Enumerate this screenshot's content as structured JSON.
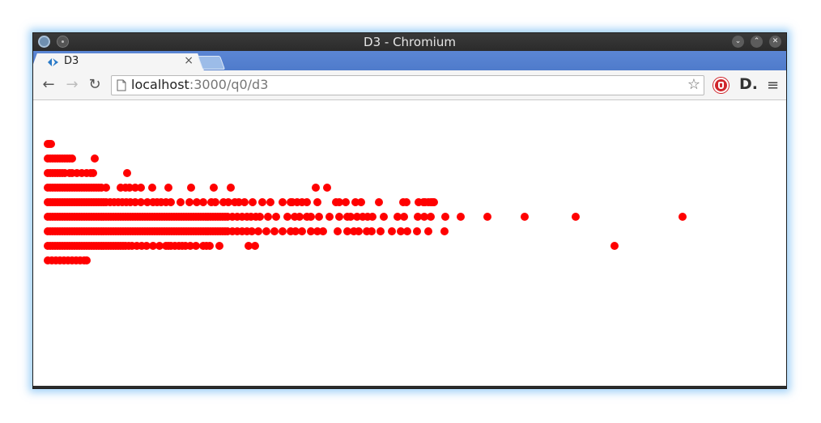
{
  "window": {
    "title": "D3 - Chromium"
  },
  "tab": {
    "title": "D3",
    "close_label": "×"
  },
  "toolbar": {
    "back_label": "←",
    "forward_label": "→",
    "reload_label": "↻",
    "url_host": "localhost",
    "url_path": ":3000/q0/d3",
    "star_label": "☆",
    "ext_d_label": "D.",
    "menu_label": "≡"
  },
  "colors": {
    "dot": "#ff0000",
    "tabstrip": "#5b86d4"
  },
  "chart_data": {
    "type": "scatter",
    "title": "",
    "xlabel": "",
    "ylabel": "",
    "grid": false,
    "legend": "none",
    "series": [
      {
        "row": 0,
        "x": [
          0,
          2,
          4
        ]
      },
      {
        "row": 1,
        "x": [
          0,
          3,
          6,
          9,
          12,
          15,
          18,
          21,
          24,
          27,
          30,
          58
        ]
      },
      {
        "row": 2,
        "x": [
          0,
          3,
          6,
          9,
          12,
          15,
          18,
          21,
          27,
          30,
          36,
          42,
          48,
          53,
          56,
          98
        ]
      },
      {
        "row": 3,
        "x": [
          0,
          3,
          6,
          9,
          12,
          15,
          18,
          21,
          24,
          27,
          30,
          33,
          36,
          39,
          42,
          45,
          48,
          51,
          54,
          57,
          60,
          63,
          66,
          72,
          90,
          96,
          101,
          108,
          115,
          129,
          149,
          177,
          205,
          226,
          331,
          345
        ]
      },
      {
        "row": 4,
        "x": [
          0,
          3,
          6,
          9,
          12,
          15,
          18,
          21,
          24,
          27,
          30,
          33,
          36,
          39,
          42,
          45,
          48,
          51,
          54,
          57,
          60,
          63,
          66,
          69,
          72,
          77,
          82,
          87,
          92,
          97,
          102,
          108,
          115,
          123,
          130,
          135,
          140,
          146,
          152,
          164,
          175,
          184,
          192,
          202,
          207,
          217,
          223,
          231,
          236,
          243,
          253,
          265,
          275,
          290,
          300,
          302,
          308,
          314,
          320,
          333,
          356,
          360,
          368,
          380,
          387,
          409,
          439,
          443,
          458,
          464,
          466,
          470,
          473,
          475,
          477
        ]
      },
      {
        "row": 5,
        "x": [
          0,
          3,
          6,
          9,
          12,
          15,
          18,
          21,
          24,
          27,
          30,
          33,
          36,
          39,
          42,
          45,
          48,
          51,
          54,
          57,
          60,
          63,
          66,
          69,
          72,
          75,
          78,
          81,
          84,
          87,
          90,
          93,
          96,
          99,
          102,
          105,
          108,
          111,
          114,
          117,
          120,
          123,
          126,
          129,
          132,
          135,
          138,
          141,
          144,
          147,
          150,
          153,
          156,
          159,
          162,
          165,
          168,
          171,
          174,
          177,
          180,
          183,
          186,
          189,
          192,
          195,
          198,
          201,
          204,
          207,
          210,
          213,
          216,
          219,
          222,
          228,
          234,
          240,
          246,
          251,
          257,
          262,
          272,
          282,
          296,
          305,
          311,
          320,
          325,
          335,
          348,
          360,
          370,
          374,
          382,
          389,
          395,
          401,
          415,
          432,
          440,
          457,
          465,
          473,
          491,
          510,
          543,
          589,
          652,
          784
        ]
      },
      {
        "row": 6,
        "x": [
          0,
          3,
          6,
          9,
          12,
          15,
          18,
          21,
          24,
          27,
          30,
          33,
          36,
          39,
          42,
          45,
          48,
          51,
          54,
          57,
          60,
          63,
          66,
          69,
          72,
          75,
          78,
          81,
          84,
          87,
          90,
          93,
          96,
          99,
          102,
          105,
          108,
          111,
          114,
          117,
          120,
          123,
          126,
          129,
          132,
          135,
          138,
          141,
          144,
          147,
          150,
          153,
          156,
          159,
          162,
          165,
          168,
          171,
          174,
          177,
          180,
          183,
          186,
          189,
          192,
          195,
          198,
          201,
          204,
          207,
          210,
          213,
          216,
          219,
          222,
          228,
          234,
          240,
          246,
          252,
          260,
          270,
          280,
          290,
          300,
          306,
          314,
          325,
          333,
          340,
          358,
          370,
          378,
          384,
          394,
          400,
          411,
          425,
          436,
          444,
          456,
          470,
          490
        ]
      },
      {
        "row": 7,
        "x": [
          0,
          3,
          6,
          9,
          12,
          15,
          18,
          21,
          24,
          27,
          30,
          33,
          36,
          39,
          42,
          45,
          48,
          51,
          54,
          57,
          60,
          63,
          66,
          69,
          72,
          75,
          78,
          81,
          84,
          87,
          90,
          93,
          96,
          100,
          104,
          110,
          116,
          122,
          130,
          138,
          146,
          149,
          152,
          157,
          162,
          166,
          170,
          176,
          183,
          192,
          196,
          200,
          212,
          248,
          256,
          700
        ]
      },
      {
        "row": 8,
        "x": [
          0,
          5,
          10,
          15,
          20,
          25,
          30,
          35,
          40,
          45,
          48
        ]
      }
    ]
  }
}
